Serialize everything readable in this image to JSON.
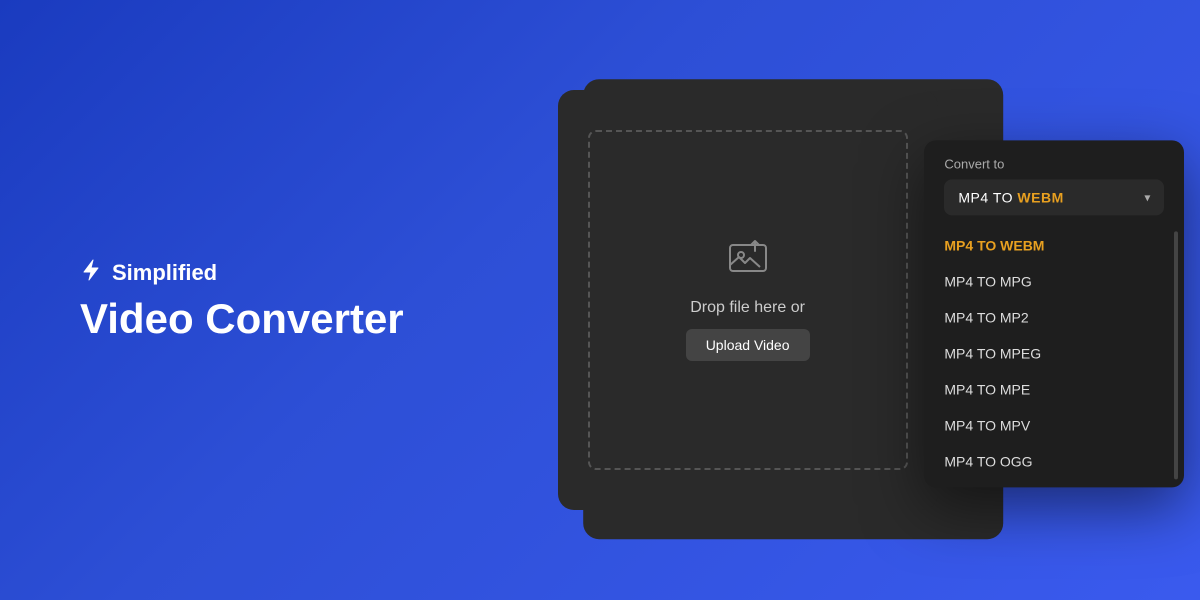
{
  "brand": {
    "icon": "⚡",
    "name": "Simplified",
    "title": "Video Converter"
  },
  "upload": {
    "drop_text": "Drop file here or",
    "button_label": "Upload Video"
  },
  "convert": {
    "label": "Convert to",
    "selected": {
      "prefix": "MP4 TO ",
      "value": "WEBM"
    },
    "options": [
      {
        "label": "MP4 TO WEBM",
        "active": true
      },
      {
        "label": "MP4 TO MPG",
        "active": false
      },
      {
        "label": "MP4 TO MP2",
        "active": false
      },
      {
        "label": "MP4 TO MPEG",
        "active": false
      },
      {
        "label": "MP4 TO MPE",
        "active": false
      },
      {
        "label": "MP4 TO MPV",
        "active": false
      },
      {
        "label": "MP4 TO OGG",
        "active": false
      }
    ]
  }
}
